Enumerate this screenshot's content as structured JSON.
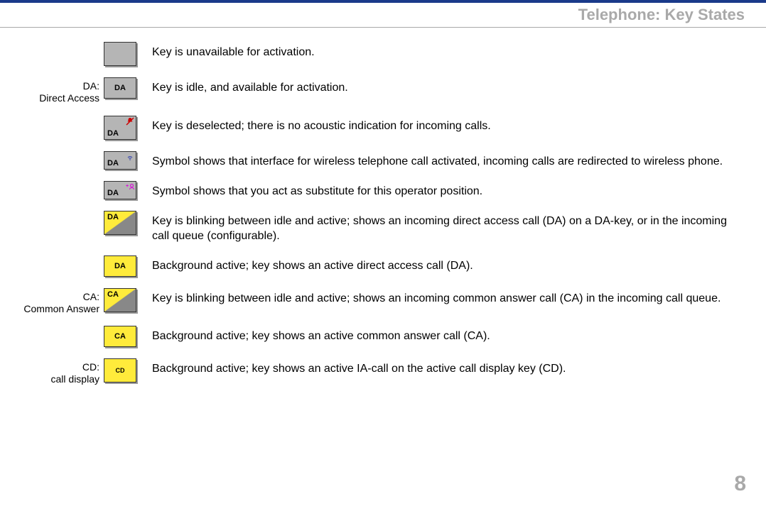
{
  "header": {
    "title": "Telephone: Key States"
  },
  "pageNumber": "8",
  "sideLabels": {
    "da": {
      "line1": "DA:",
      "line2": "Direct Access"
    },
    "ca": {
      "line1": "CA:",
      "line2": "Common Answer"
    },
    "cd": {
      "line1": "CD:",
      "line2": "call display"
    }
  },
  "keys": {
    "r1": {
      "label": ""
    },
    "r2": {
      "label": "DA"
    },
    "r3": {
      "label": "DA"
    },
    "r4": {
      "label": "DA"
    },
    "r5": {
      "label": "DA"
    },
    "r6": {
      "label": "DA"
    },
    "r7": {
      "label": "DA"
    },
    "r8": {
      "label": "CA"
    },
    "r9": {
      "label": "CA"
    },
    "r10": {
      "label": "CD"
    }
  },
  "descriptions": {
    "r1": "Key is unavailable for activation.",
    "r2": "Key is idle, and available for activation.",
    "r3": "Key is deselected; there is no acoustic indication for incoming calls.",
    "r4": "Symbol shows that interface for wireless telephone call activated, incoming calls are redirected to wireless phone.",
    "r5": "Symbol shows that you act as substitute for this operator position.",
    "r6": "Key is blinking between idle and active; shows an incoming direct access call (DA) on a DA-key, or in the incoming call queue (configurable).",
    "r7": "Background active; key shows an active direct access call (DA).",
    "r8": "Key is blinking between idle and active; shows an incoming common answer call  (CA) in the incoming call queue.",
    "r9": "Background active; key shows an active common answer call (CA).",
    "r10": "Background active; key shows an active IA-call on the active call display key (CD)."
  },
  "icons": {
    "bellOff": "bell-off-icon",
    "wireless": "wireless-icon",
    "substitute": "substitute-icon"
  }
}
